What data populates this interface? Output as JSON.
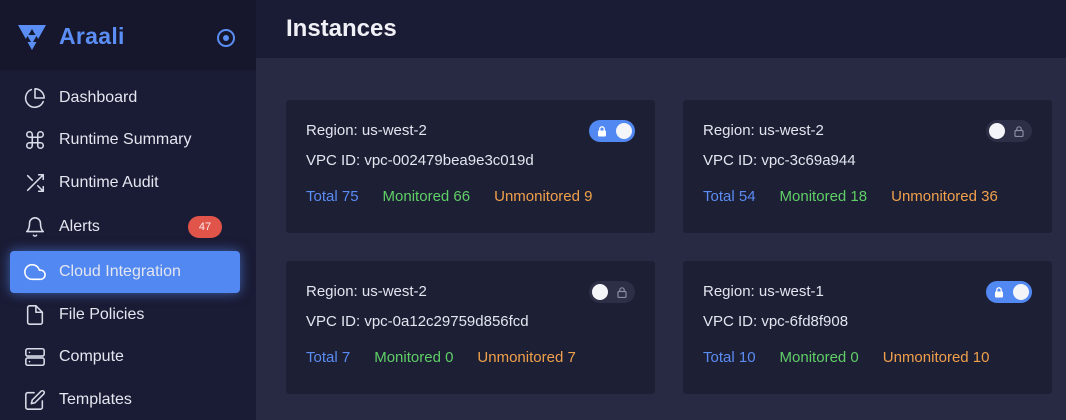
{
  "app": {
    "name": "Araali"
  },
  "page": {
    "title": "Instances"
  },
  "sidebar": {
    "items": [
      {
        "label": "Dashboard",
        "icon": "pie-chart-icon"
      },
      {
        "label": "Runtime Summary",
        "icon": "command-icon"
      },
      {
        "label": "Runtime Audit",
        "icon": "shuffle-icon"
      },
      {
        "label": "Alerts",
        "icon": "bell-icon",
        "badge": "47"
      },
      {
        "label": "Cloud Integration",
        "icon": "cloud-icon",
        "active": true
      },
      {
        "label": "File Policies",
        "icon": "file-icon"
      },
      {
        "label": "Compute",
        "icon": "server-icon"
      },
      {
        "label": "Templates",
        "icon": "edit-icon"
      }
    ]
  },
  "instances": [
    {
      "region": "Region: us-west-2",
      "vpc": "VPC ID: vpc-002479bea9e3c019d",
      "total": "Total 75",
      "monitored": "Monitored 66",
      "unmonitored": "Unmonitored 9",
      "enabled": true
    },
    {
      "region": "Region: us-west-2",
      "vpc": "VPC ID: vpc-3c69a944",
      "total": "Total 54",
      "monitored": "Monitored 18",
      "unmonitored": "Unmonitored 36",
      "enabled": false
    },
    {
      "region": "Region: us-west-2",
      "vpc": "VPC ID: vpc-0a12c29759d856fcd",
      "total": "Total 7",
      "monitored": "Monitored 0",
      "unmonitored": "Unmonitored 7",
      "enabled": false
    },
    {
      "region": "Region: us-west-1",
      "vpc": "VPC ID: vpc-6fd8f908",
      "total": "Total 10",
      "monitored": "Monitored 0",
      "unmonitored": "Unmonitored 10",
      "enabled": true
    }
  ],
  "colors": {
    "accent": "#5288f1",
    "total": "#5a8cf4",
    "monitored": "#5fcf66",
    "unmonitored": "#f0a04b",
    "badge": "#e0544a"
  }
}
